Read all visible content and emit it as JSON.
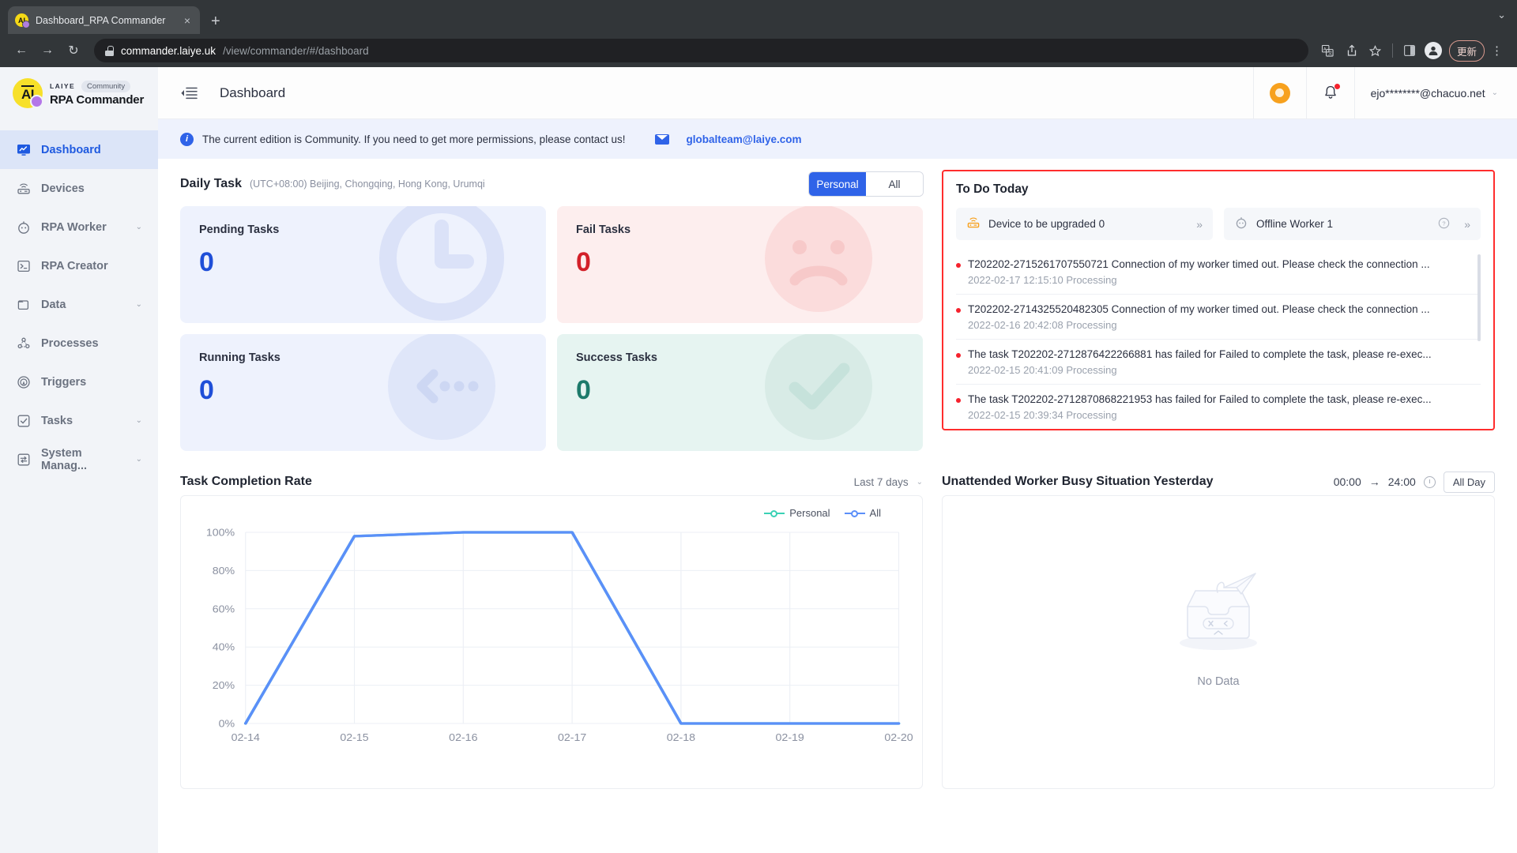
{
  "browser": {
    "tab_title": "Dashboard_RPA Commander",
    "tab_favicon": "AI",
    "new_tab_label": "+",
    "close_label": "×",
    "window_chevron": "⌄",
    "back_label": "←",
    "forward_label": "→",
    "reload_label": "↻",
    "url_host": "commander.laiye.uk",
    "url_path": "/view/commander/#/dashboard",
    "update_button": "更新",
    "kebab_label": "⋮"
  },
  "sidebar": {
    "brand_laiye": "LAIYE",
    "brand_badge": "Community",
    "brand_name": "RPA Commander",
    "items": [
      {
        "label": "Dashboard",
        "icon": "dashboard-icon",
        "active": true,
        "expandable": false
      },
      {
        "label": "Devices",
        "icon": "devices-icon",
        "active": false,
        "expandable": false
      },
      {
        "label": "RPA Worker",
        "icon": "rpa-worker-icon",
        "active": false,
        "expandable": true
      },
      {
        "label": "RPA Creator",
        "icon": "rpa-creator-icon",
        "active": false,
        "expandable": false
      },
      {
        "label": "Data",
        "icon": "folder-icon",
        "active": false,
        "expandable": true
      },
      {
        "label": "Processes",
        "icon": "processes-icon",
        "active": false,
        "expandable": false
      },
      {
        "label": "Triggers",
        "icon": "triggers-icon",
        "active": false,
        "expandable": false
      },
      {
        "label": "Tasks",
        "icon": "tasks-icon",
        "active": false,
        "expandable": true
      },
      {
        "label": "System Manag...",
        "icon": "system-management-icon",
        "active": false,
        "expandable": true
      }
    ],
    "chevron": "⌄"
  },
  "header": {
    "title": "Dashboard",
    "collapse_icon": "collapse-menu-icon",
    "tip_icon": "lightbulb-icon",
    "notification_icon": "bell-icon",
    "user_email": "ejo********@chacuo.net",
    "user_chevron": "⌄"
  },
  "banner": {
    "icon": "info-icon",
    "text": "The current edition is Community. If you need to get more permissions, please contact us!",
    "mail_icon": "mail-icon",
    "link": "globalteam@laiye.com"
  },
  "daily_task": {
    "title": "Daily Task",
    "timezone": "(UTC+08:00) Beijing, Chongqing, Hong Kong, Urumqi",
    "toggle": {
      "options": [
        "Personal",
        "All"
      ],
      "selected": "Personal"
    },
    "cards": [
      {
        "label": "Pending Tasks",
        "value": "0",
        "watermark": "clock-icon"
      },
      {
        "label": "Fail Tasks",
        "value": "0",
        "watermark": "sad-face-icon"
      },
      {
        "label": "Running Tasks",
        "value": "0",
        "watermark": "running-icon"
      },
      {
        "label": "Success Tasks",
        "value": "0",
        "watermark": "check-circle-icon"
      }
    ]
  },
  "todo": {
    "title": "To Do Today",
    "chips": [
      {
        "label": "Device to be upgraded 0",
        "icon": "device-upgrade-icon",
        "arrow": "»",
        "help": ""
      },
      {
        "label": "Offline Worker 1",
        "icon": "worker-icon",
        "arrow": "»",
        "help": "?"
      }
    ],
    "items": [
      {
        "text": "T202202-2715261707550721 Connection of my worker timed out. Please check the connection ...",
        "meta": "2022-02-17 12:15:10 Processing"
      },
      {
        "text": "T202202-2714325520482305 Connection of my worker timed out. Please check the connection ...",
        "meta": "2022-02-16 20:42:08 Processing"
      },
      {
        "text": "The task T202202-2712876422266881 has failed for Failed to complete the task, please re-exec...",
        "meta": "2022-02-15 20:41:09 Processing"
      },
      {
        "text": "The task T202202-2712870868221953 has failed for Failed to complete the task, please re-exec...",
        "meta": "2022-02-15 20:39:34 Processing"
      }
    ]
  },
  "completion_panel": {
    "title": "Task Completion Rate",
    "range_label": "Last 7 days",
    "range_chevron": "⌄"
  },
  "busy_panel": {
    "title": "Unattended Worker Busy Situation Yesterday",
    "time_start": "00:00",
    "time_arrow": "→",
    "time_end": "24:00",
    "clock_icon": "clock-icon",
    "all_day_button": "All Day",
    "empty_text": "No Data",
    "empty_icon": "empty-box-icon"
  },
  "chart_data": {
    "type": "line",
    "title": "Task Completion Rate",
    "xlabel": "",
    "ylabel": "",
    "x": [
      "02-14",
      "02-15",
      "02-16",
      "02-17",
      "02-18",
      "02-19",
      "02-20"
    ],
    "ylim": [
      0,
      100
    ],
    "yticks": [
      0,
      20,
      40,
      60,
      80,
      100
    ],
    "ytick_labels": [
      "0%",
      "20%",
      "40%",
      "60%",
      "80%",
      "100%"
    ],
    "grid": true,
    "legend_position": "top-right",
    "series": [
      {
        "name": "Personal",
        "color": "#3ad1b5",
        "values": [
          0,
          98,
          100,
          100,
          0,
          0,
          0
        ]
      },
      {
        "name": "All",
        "color": "#5b8ff9",
        "values": [
          0,
          98,
          100,
          100,
          0,
          0,
          0
        ]
      }
    ]
  },
  "colors": {
    "accent": "#2f63e8",
    "danger": "#d32029",
    "success": "#1d7a6b",
    "highlight_border": "#ff2d2d",
    "brand_yellow": "#f7e02a"
  }
}
